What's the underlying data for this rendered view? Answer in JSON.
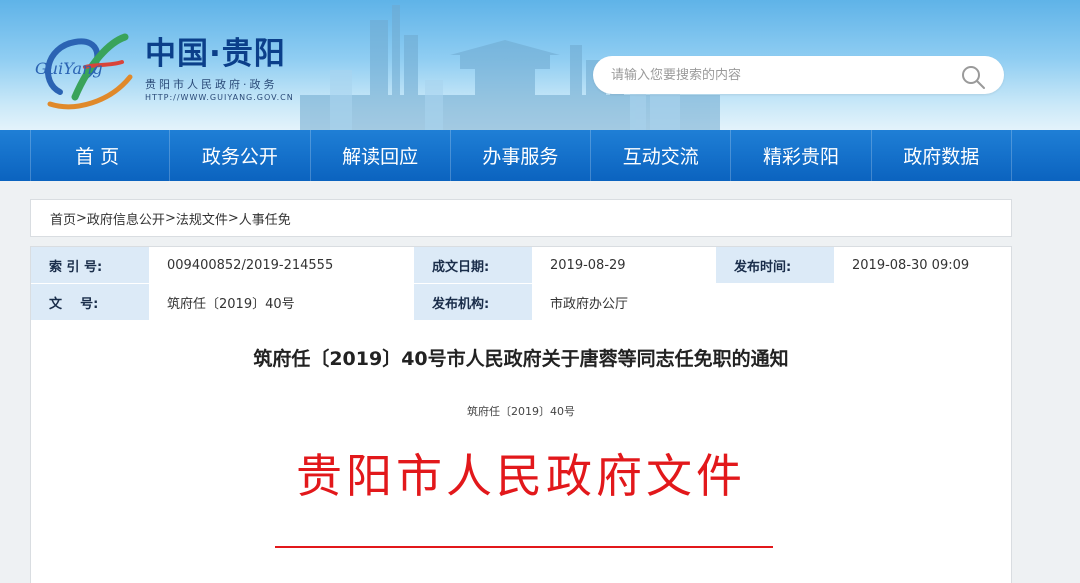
{
  "header": {
    "logo_text": "GuiYang",
    "site_title": "中国·贵阳",
    "site_subtitle": "贵阳市人民政府·政务",
    "site_url": "HTTP://WWW.GUIYANG.GOV.CN"
  },
  "search": {
    "placeholder": "请输入您要搜索的内容"
  },
  "nav": {
    "items": [
      "首页",
      "政务公开",
      "解读回应",
      "办事服务",
      "互动交流",
      "精彩贵阳",
      "政府数据"
    ]
  },
  "breadcrumb": {
    "items": [
      "首页",
      "政府信息公开",
      "法规文件",
      "人事任免"
    ],
    "separator": ">"
  },
  "meta": {
    "index_label": "索 引 号:",
    "index_value": "009400852/2019-214555",
    "date_label": "成文日期:",
    "date_value": "2019-08-29",
    "publish_time_label": "发布时间:",
    "publish_time_value": "2019-08-30 09:09",
    "doc_no_label": "文    号:",
    "doc_no_value": "筑府任〔2019〕40号",
    "publisher_label": "发布机构:",
    "publisher_value": "市政府办公厅"
  },
  "document": {
    "title": "筑府任〔2019〕40号市人民政府关于唐蓉等同志任免职的通知",
    "number": "筑府任〔2019〕40号",
    "red_header": "贵阳市人民政府文件"
  },
  "colors": {
    "nav_blue": "#0b63bf",
    "label_bg": "#dceaf7",
    "red": "#e2181b",
    "title_blue": "#0b3f8a"
  }
}
